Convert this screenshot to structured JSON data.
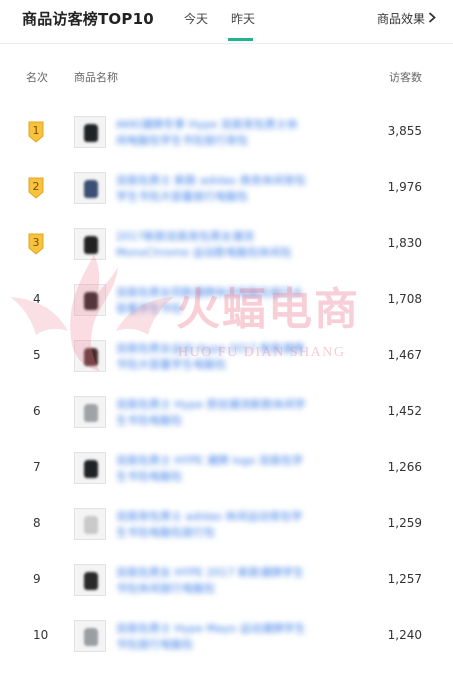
{
  "header": {
    "title": "商品访客榜TOP10",
    "tabs": [
      {
        "label": "今天",
        "active": false
      },
      {
        "label": "昨天",
        "active": true
      }
    ],
    "link_label": "商品效果",
    "accent": "#1fb492"
  },
  "columns": {
    "rank": "名次",
    "name": "商品名称",
    "visitors": "访客数"
  },
  "rows": [
    {
      "rank": "1",
      "visitors": "3,855",
      "name": "AKKI潮牌冬季 Hype 双肩背包男士休闲电脑包学生书包旅行背包",
      "thumb": "dark-backpack"
    },
    {
      "rank": "2",
      "visitors": "1,976",
      "name": "双肩包男士 新款 adidas 商务休闲背包学生书包大容量旅行电脑包",
      "thumb": "navy-backpack"
    },
    {
      "rank": "3",
      "visitors": "1,830",
      "name": "2017新款双肩背包男女潮流 MonoChrome 运动款电脑包休闲包",
      "thumb": "black-watch"
    },
    {
      "rank": "4",
      "visitors": "1,708",
      "name": "双肩包男女同款潮牌休闲电脑包旅行大容量学生书包",
      "thumb": "black-cap"
    },
    {
      "rank": "5",
      "visitors": "1,467",
      "name": "双肩包男女运动 Hype 2017 新款潮牌书包大容量学生电脑包",
      "thumb": "person"
    },
    {
      "rank": "6",
      "visitors": "1,452",
      "name": "双肩包男士 Hype 原创潮流新款休闲学生书包电脑包",
      "thumb": "white-backpack"
    },
    {
      "rank": "7",
      "visitors": "1,266",
      "name": "双肩包男士 HYPE 潮牌 logo 双肩包学生书包电脑包",
      "thumb": "dark-backpack"
    },
    {
      "rank": "8",
      "visitors": "1,259",
      "name": "双肩背包男士 adidas 休闲运动背包学生书包电脑包旅行包",
      "thumb": "white-card"
    },
    {
      "rank": "9",
      "visitors": "1,257",
      "name": "双肩包男女 HYPE 2017 新款潮牌学生书包休闲旅行电脑包",
      "thumb": "pair-bags"
    },
    {
      "rank": "10",
      "visitors": "1,240",
      "name": "双肩包男士 Hype Mayo 运动潮牌学生书包旅行电脑包",
      "thumb": "grey-backpack"
    }
  ],
  "watermark": {
    "main": "火蝠电商",
    "sub": "HUO FU DIAN SHANG"
  },
  "colors": {
    "badge_gold": "#f7c33e",
    "link_blue": "#3c7ee6",
    "watermark_pink": "#ec8296"
  }
}
